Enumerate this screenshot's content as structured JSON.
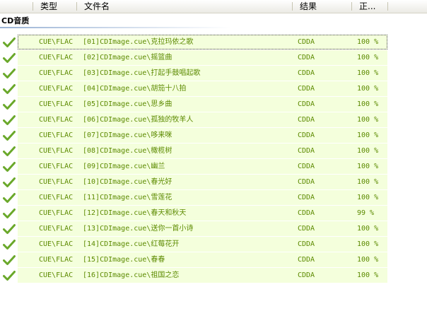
{
  "columns": {
    "type": "类型",
    "filename": "文件名",
    "result": "结果",
    "progress": "正..."
  },
  "group": {
    "title": "CD音质"
  },
  "colors": {
    "accent_text": "#5c8a00",
    "row_bg": "#f4ffdc",
    "check": "#6aa82a"
  },
  "rows": [
    {
      "type": "CUE\\FLAC",
      "file": "[01]CDImage.cue\\克拉玛依之歌",
      "result": "CDDA",
      "progress": "100 %"
    },
    {
      "type": "CUE\\FLAC",
      "file": "[02]CDImage.cue\\摇篮曲",
      "result": "CDDA",
      "progress": "100 %"
    },
    {
      "type": "CUE\\FLAC",
      "file": "[03]CDImage.cue\\打起手鼓唱起歌",
      "result": "CDDA",
      "progress": "100 %"
    },
    {
      "type": "CUE\\FLAC",
      "file": "[04]CDImage.cue\\胡笳十八拍",
      "result": "CDDA",
      "progress": "100 %"
    },
    {
      "type": "CUE\\FLAC",
      "file": "[05]CDImage.cue\\思乡曲",
      "result": "CDDA",
      "progress": "100 %"
    },
    {
      "type": "CUE\\FLAC",
      "file": "[06]CDImage.cue\\孤独的牧羊人",
      "result": "CDDA",
      "progress": "100 %"
    },
    {
      "type": "CUE\\FLAC",
      "file": "[07]CDImage.cue\\哆来咪",
      "result": "CDDA",
      "progress": "100 %"
    },
    {
      "type": "CUE\\FLAC",
      "file": "[08]CDImage.cue\\橄榄树",
      "result": "CDDA",
      "progress": "100 %"
    },
    {
      "type": "CUE\\FLAC",
      "file": "[09]CDImage.cue\\幽兰",
      "result": "CDDA",
      "progress": "100 %"
    },
    {
      "type": "CUE\\FLAC",
      "file": "[10]CDImage.cue\\春光好",
      "result": "CDDA",
      "progress": "100 %"
    },
    {
      "type": "CUE\\FLAC",
      "file": "[11]CDImage.cue\\雪莲花",
      "result": "CDDA",
      "progress": "100 %"
    },
    {
      "type": "CUE\\FLAC",
      "file": "[12]CDImage.cue\\春天和秋天",
      "result": "CDDA",
      "progress": "99 %"
    },
    {
      "type": "CUE\\FLAC",
      "file": "[13]CDImage.cue\\送你一首小诗",
      "result": "CDDA",
      "progress": "100 %"
    },
    {
      "type": "CUE\\FLAC",
      "file": "[14]CDImage.cue\\红莓花开",
      "result": "CDDA",
      "progress": "100 %"
    },
    {
      "type": "CUE\\FLAC",
      "file": "[15]CDImage.cue\\春春",
      "result": "CDDA",
      "progress": "100 %"
    },
    {
      "type": "CUE\\FLAC",
      "file": "[16]CDImage.cue\\祖国之恋",
      "result": "CDDA",
      "progress": "100 %"
    }
  ]
}
